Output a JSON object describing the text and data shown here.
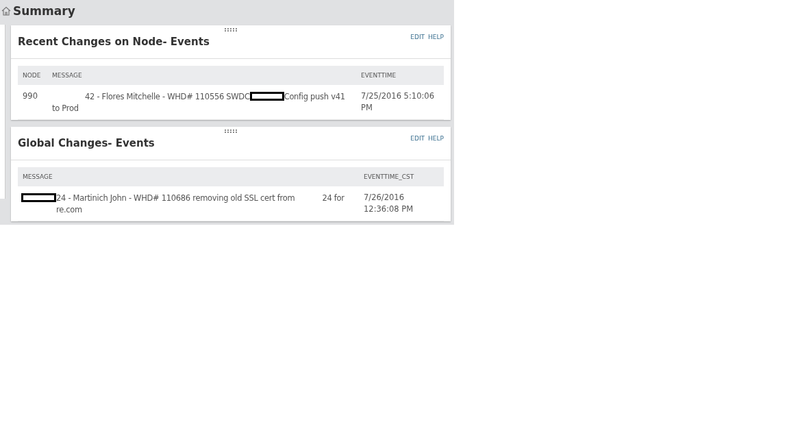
{
  "header": {
    "title": "Summary"
  },
  "panels": [
    {
      "title": "Recent Changes on Node- Events",
      "actions": [
        "EDIT",
        "HELP"
      ],
      "columns": [
        "NODE",
        "MESSAGE",
        "EVENTTIME"
      ],
      "rows": [
        {
          "node": "990",
          "message_lines": [
            [
              {
                "kind": "blank"
              },
              {
                "kind": "text",
                "text": "42 - Flores Mitchelle - WHD# 110556 SWDC"
              },
              {
                "kind": "redaction"
              },
              {
                "kind": "text",
                "text": "Config push v41"
              }
            ],
            [
              {
                "kind": "text",
                "text": "to Prod"
              }
            ]
          ],
          "time": "7/25/2016 5:10:06 PM"
        }
      ]
    },
    {
      "title": "Global Changes- Events",
      "actions": [
        "EDIT",
        "HELP"
      ],
      "columns": [
        "MESSAGE",
        "EVENTTIME_CST"
      ],
      "rows": [
        {
          "message_lines": [
            [
              {
                "kind": "redaction"
              },
              {
                "kind": "text",
                "text": "24 - Martinich John - WHD# 110686 removing old SSL cert from"
              },
              {
                "kind": "gap"
              },
              {
                "kind": "text",
                "text": "24 for"
              }
            ],
            [
              {
                "kind": "blank"
              },
              {
                "kind": "text",
                "text": "re.com"
              }
            ]
          ],
          "time": "7/26/2016 12:36:08 PM"
        }
      ]
    }
  ]
}
